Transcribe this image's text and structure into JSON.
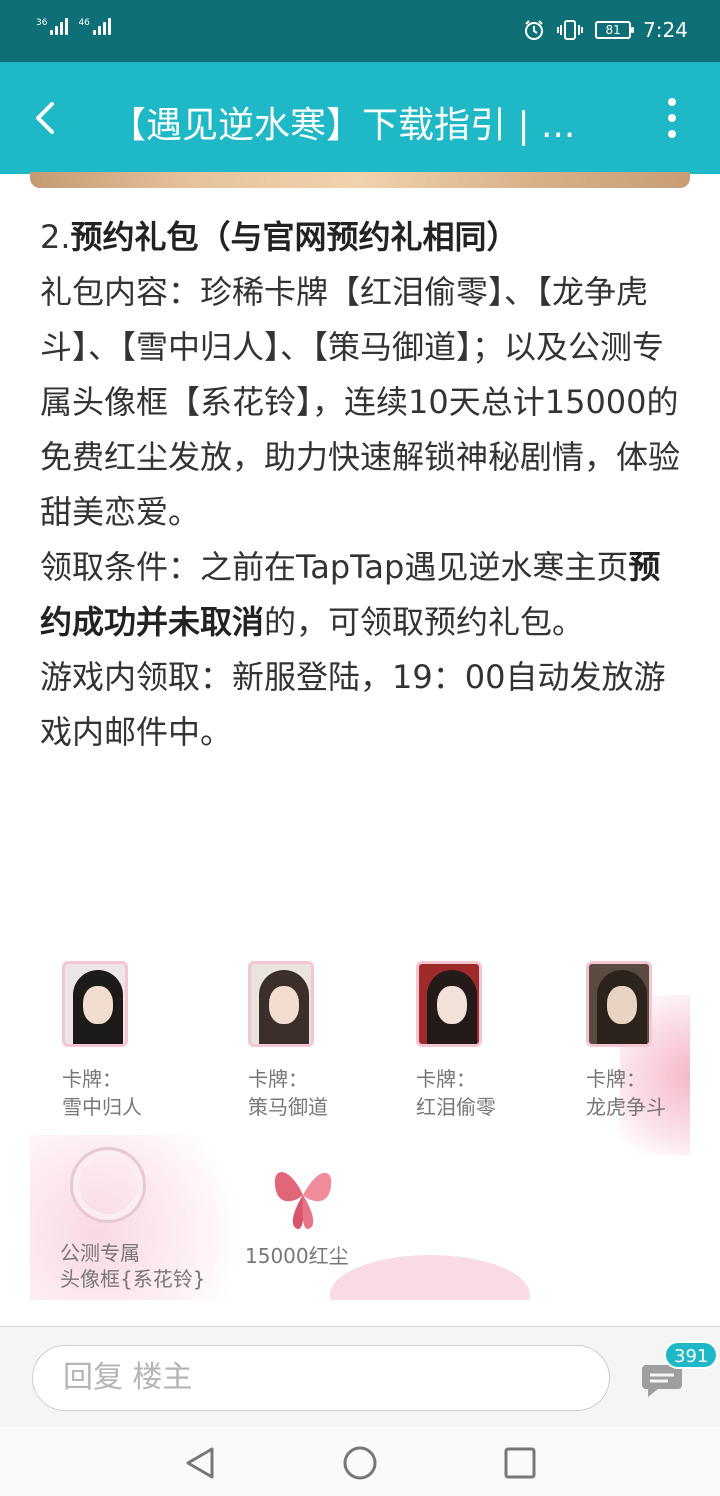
{
  "status_bar": {
    "signal1_label": "36",
    "signal2_label": "46",
    "battery_level": "81",
    "time": "7:24"
  },
  "header": {
    "title": "【遇见逆水寒】下载指引 | ..."
  },
  "article": {
    "heading_prefix": "2.",
    "heading_bold": "预约礼包（与官网预约礼相同）",
    "content_text": "礼包内容：珍稀卡牌【红泪偷零】、【龙争虎斗】、【雪中归人】、【策马御道】；以及公测专属头像框【系花铃】，连续10天总计15000的免费红尘发放，助力快速解锁神秘剧情，体验甜美恋爱。",
    "condition_prefix": "领取条件：之前在TapTap遇见逆水寒主页",
    "condition_bold": "预约成功并未取消",
    "condition_suffix": "的，可领取预约礼包。",
    "ingame_text": "游戏内领取：新服登陆，19：00自动发放游戏内邮件中。"
  },
  "rewards": {
    "cards": [
      {
        "label": "卡牌：\n雪中归人"
      },
      {
        "label": "卡牌：\n策马御道"
      },
      {
        "label": "卡牌：\n红泪偷零"
      },
      {
        "label": "卡牌：\n龙虎争斗"
      }
    ],
    "frame_label": "公测专属\n头像框{系花铃}",
    "dust_label": "15000红尘"
  },
  "reply_bar": {
    "placeholder": "回复  楼主",
    "comment_count": "391"
  },
  "colors": {
    "status_bar": "#0f6f76",
    "header": "#1eb8c7",
    "accent": "#1eb8c7"
  },
  "icons": {
    "back": "arrow-left-icon",
    "more": "more-vertical-icon",
    "comment": "comment-bubble-icon",
    "nav_back": "triangle-back-icon",
    "nav_home": "circle-home-icon",
    "nav_recent": "square-recent-icon"
  }
}
